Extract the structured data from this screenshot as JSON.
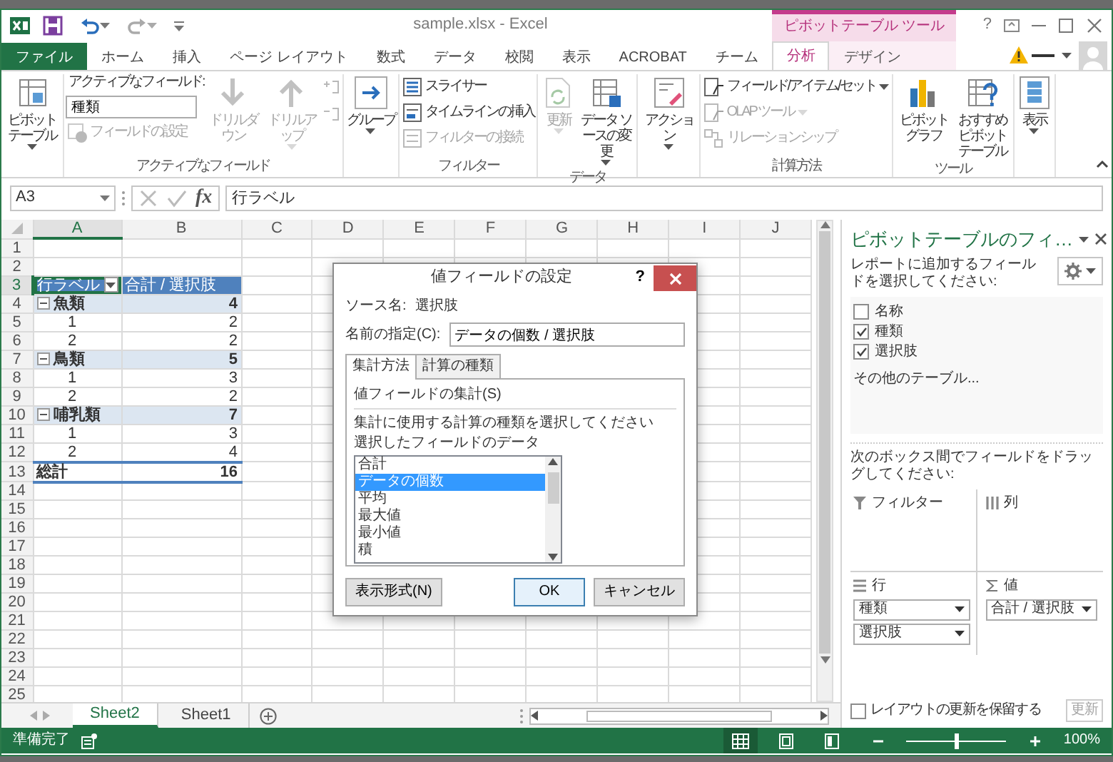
{
  "window": {
    "title": "sample.xlsx - Excel",
    "contextual_group": "ピボットテーブル ツール",
    "help": "?"
  },
  "ribbon_tabs": [
    {
      "label": "ファイル",
      "kind": "file",
      "selected": false
    },
    {
      "label": "ホーム",
      "kind": "normal",
      "selected": false
    },
    {
      "label": "挿入",
      "kind": "normal",
      "selected": false
    },
    {
      "label": "ページ レイアウト",
      "kind": "normal",
      "selected": false
    },
    {
      "label": "数式",
      "kind": "normal",
      "selected": false
    },
    {
      "label": "データ",
      "kind": "normal",
      "selected": false
    },
    {
      "label": "校閲",
      "kind": "normal",
      "selected": false
    },
    {
      "label": "表示",
      "kind": "normal",
      "selected": false
    },
    {
      "label": "ACROBAT",
      "kind": "normal",
      "selected": false
    },
    {
      "label": "チーム",
      "kind": "normal",
      "selected": false
    },
    {
      "label": "分析",
      "kind": "contextual",
      "selected": true
    },
    {
      "label": "デザイン",
      "kind": "contextual",
      "selected": false
    }
  ],
  "ribbon_groups": [
    {
      "items": [
        {
          "kind": "large",
          "label": "ピボットテーブル",
          "caret": true,
          "disabled": false
        }
      ]
    },
    {
      "label": "アクティブなフィールド",
      "items": [
        {
          "kind": "stack",
          "items": [
            {
              "kind": "caption",
              "label": "アクティブなフィールド:"
            },
            {
              "kind": "input",
              "value": "種類"
            },
            {
              "kind": "small",
              "label": "フィールドの設定",
              "disabled": true
            }
          ]
        },
        {
          "kind": "large",
          "label": "ドリルダウン",
          "caret": false,
          "disabled": true
        },
        {
          "kind": "large",
          "label": "ドリルアップ",
          "caret": true,
          "disabled": true
        },
        {
          "kind": "stack",
          "items": [
            {
              "kind": "icon",
              "disabled": true
            },
            {
              "kind": "icon",
              "disabled": true
            }
          ]
        }
      ]
    },
    {
      "items": [
        {
          "kind": "large",
          "label": "グループ",
          "caret": true,
          "disabled": false
        }
      ]
    },
    {
      "label": "フィルター",
      "items": [
        {
          "kind": "stack",
          "items": [
            {
              "kind": "small",
              "label": "スライサー",
              "disabled": false
            },
            {
              "kind": "small",
              "label": "タイムラインの挿入",
              "disabled": false
            },
            {
              "kind": "small",
              "label": "フィルターの接続",
              "disabled": true
            }
          ]
        }
      ]
    },
    {
      "label": "データ",
      "items": [
        {
          "kind": "large",
          "label": "更新",
          "caret": true,
          "disabled": true
        },
        {
          "kind": "large",
          "label": "データ ソースの変更",
          "caret": true,
          "disabled": false
        }
      ]
    },
    {
      "items": [
        {
          "kind": "large",
          "label": "アクション",
          "caret": true,
          "disabled": false
        }
      ]
    },
    {
      "label": "計算方法",
      "items": [
        {
          "kind": "stack",
          "items": [
            {
              "kind": "small",
              "label": "フィールド/アイテム/セット",
              "caret": true,
              "disabled": false
            },
            {
              "kind": "small",
              "label": "OLAP ツール",
              "caret": true,
              "disabled": true
            },
            {
              "kind": "small",
              "label": "リレーションシップ",
              "disabled": true
            }
          ]
        }
      ]
    },
    {
      "label": "ツール",
      "items": [
        {
          "kind": "large",
          "label": "ピボットグラフ",
          "caret": false,
          "disabled": false
        },
        {
          "kind": "large",
          "label": "おすすめピボットテーブル",
          "caret": false,
          "disabled": false
        }
      ]
    },
    {
      "items": [
        {
          "kind": "large",
          "label": "表示",
          "caret": true,
          "disabled": false
        }
      ]
    }
  ],
  "formula_bar": {
    "name_box": "A3",
    "function_label": "fx",
    "content": "行ラベル"
  },
  "sheet": {
    "columns": [
      {
        "label": "A",
        "selected": true
      },
      {
        "label": "B",
        "selected": false
      },
      {
        "label": "C",
        "selected": false
      },
      {
        "label": "D",
        "selected": false
      },
      {
        "label": "E",
        "selected": false
      },
      {
        "label": "F",
        "selected": false
      },
      {
        "label": "G",
        "selected": false
      },
      {
        "label": "H",
        "selected": false
      },
      {
        "label": "I",
        "selected": false
      },
      {
        "label": "J",
        "selected": false
      }
    ],
    "rows": [
      {
        "number": "1",
        "kind": "blank",
        "selected": false
      },
      {
        "number": "2",
        "kind": "blank",
        "selected": false
      },
      {
        "number": "3",
        "kind": "header",
        "selected": true,
        "a": "行ラベル",
        "b": "合計 / 選択肢"
      },
      {
        "number": "4",
        "kind": "group",
        "selected": false,
        "a": "魚類",
        "b": "4",
        "expanded": true
      },
      {
        "number": "5",
        "kind": "item",
        "selected": false,
        "a": "1",
        "b": "2"
      },
      {
        "number": "6",
        "kind": "item",
        "selected": false,
        "a": "2",
        "b": "2"
      },
      {
        "number": "7",
        "kind": "group",
        "selected": false,
        "a": "鳥類",
        "b": "5",
        "expanded": true
      },
      {
        "number": "8",
        "kind": "item",
        "selected": false,
        "a": "1",
        "b": "3"
      },
      {
        "number": "9",
        "kind": "item",
        "selected": false,
        "a": "2",
        "b": "2"
      },
      {
        "number": "10",
        "kind": "group",
        "selected": false,
        "a": "哺乳類",
        "b": "7",
        "expanded": true
      },
      {
        "number": "11",
        "kind": "item",
        "selected": false,
        "a": "1",
        "b": "3"
      },
      {
        "number": "12",
        "kind": "item",
        "selected": false,
        "a": "2",
        "b": "4"
      },
      {
        "number": "13",
        "kind": "total",
        "selected": false,
        "a": "総計",
        "b": "16"
      },
      {
        "number": "14",
        "kind": "blank",
        "selected": false
      },
      {
        "number": "15",
        "kind": "blank",
        "selected": false
      },
      {
        "number": "16",
        "kind": "blank",
        "selected": false
      },
      {
        "number": "17",
        "kind": "blank",
        "selected": false
      },
      {
        "number": "18",
        "kind": "blank",
        "selected": false
      },
      {
        "number": "19",
        "kind": "blank",
        "selected": false
      },
      {
        "number": "20",
        "kind": "blank",
        "selected": false
      },
      {
        "number": "21",
        "kind": "blank",
        "selected": false
      },
      {
        "number": "22",
        "kind": "blank",
        "selected": false
      },
      {
        "number": "23",
        "kind": "blank",
        "selected": false
      },
      {
        "number": "24",
        "kind": "blank",
        "selected": false
      },
      {
        "number": "25",
        "kind": "blank",
        "selected": false
      }
    ]
  },
  "dialog": {
    "title": "値フィールドの設定",
    "help": "?",
    "source_label": "ソース名:",
    "source_value": "選択肢",
    "name_label": "名前の指定(C):",
    "name_value": "データの個数 / 選択肢",
    "tabs": [
      {
        "label": "集計方法",
        "selected": true
      },
      {
        "label": "計算の種類",
        "selected": false
      }
    ],
    "section": "値フィールドの集計(S)",
    "instruction": "集計に使用する計算の種類を選択してください",
    "list_caption": "選択したフィールドのデータ",
    "functions": [
      {
        "label": "合計",
        "selected": false
      },
      {
        "label": "データの個数",
        "selected": true
      },
      {
        "label": "平均",
        "selected": false
      },
      {
        "label": "最大値",
        "selected": false
      },
      {
        "label": "最小値",
        "selected": false
      },
      {
        "label": "積",
        "selected": false
      }
    ],
    "buttons": [
      {
        "label": "表示形式(N)",
        "kind": "secondary"
      },
      {
        "label": "OK",
        "kind": "default"
      },
      {
        "label": "キャンセル",
        "kind": "secondary"
      }
    ]
  },
  "field_pane": {
    "title": "ピボットテーブルのフィ…",
    "description": "レポートに追加するフィールドを選択してください:",
    "fields": [
      {
        "label": "名称",
        "checked": false
      },
      {
        "label": "種類",
        "checked": true
      },
      {
        "label": "選択肢",
        "checked": true
      }
    ],
    "more_tables": "その他のテーブル...",
    "drag_hint": "次のボックス間でフィールドをドラッグしてください:",
    "areas": [
      {
        "label": "フィルター",
        "kind": "filter"
      },
      {
        "label": "列",
        "kind": "columns"
      },
      {
        "label": "行",
        "kind": "rows",
        "chips": [
          "種類",
          "選択肢"
        ]
      },
      {
        "label": "値",
        "kind": "values",
        "chips": [
          "合計 / 選択肢"
        ]
      }
    ],
    "defer_update": {
      "label": "レイアウトの更新を保留する",
      "checked": false
    },
    "update_button": {
      "label": "更新",
      "disabled": true
    }
  },
  "sheet_tabs": [
    {
      "label": "Sheet2",
      "selected": true
    },
    {
      "label": "Sheet1",
      "selected": false
    }
  ],
  "status_bar": {
    "status": "準備完了",
    "views": [
      {
        "selected": true
      },
      {
        "selected": false
      },
      {
        "selected": false
      }
    ],
    "zoom": {
      "level": 0.5,
      "reading": "100%"
    }
  }
}
